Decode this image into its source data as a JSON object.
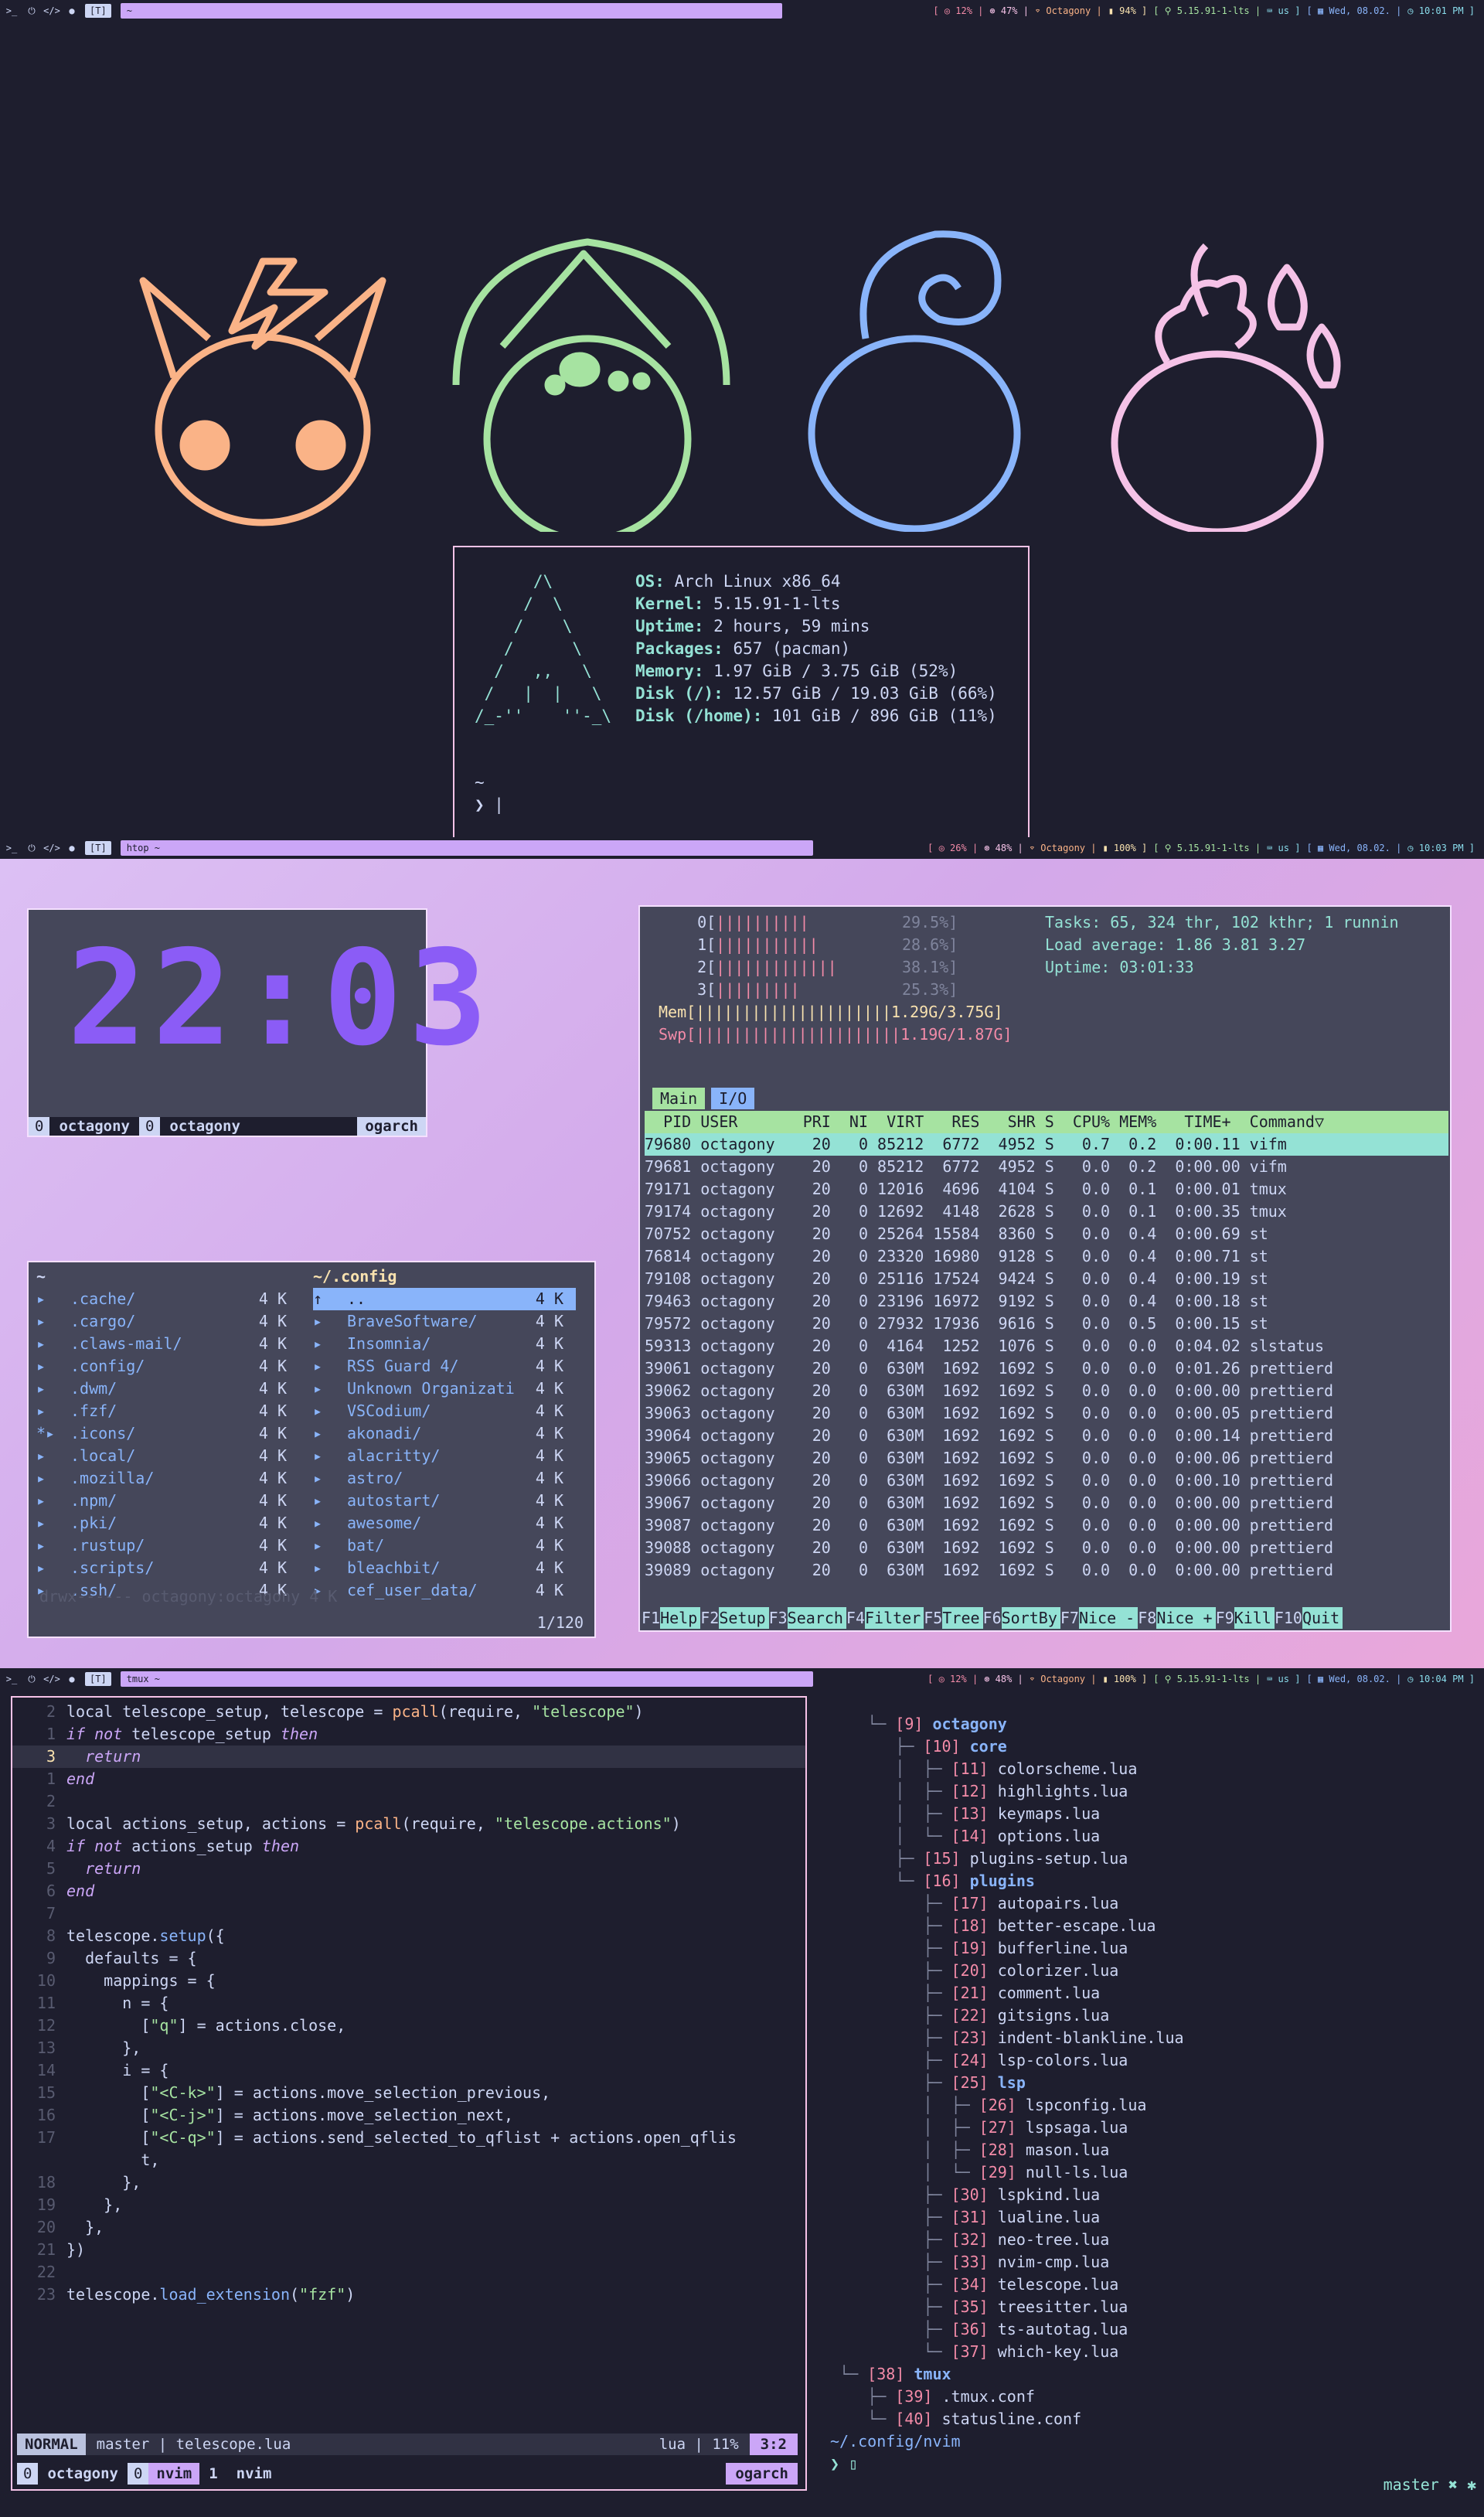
{
  "topbars": [
    {
      "tag": "[T]",
      "title": "~",
      "cpu": "12%",
      "mem": "47%",
      "wifi": "Octagony",
      "bat": "94%",
      "kernel": "5.15.91-1-lts",
      "kbd": "us",
      "date": "Wed, 08.02.",
      "time": "10:01 PM"
    },
    {
      "tag": "[T]",
      "title": "htop ~",
      "cpu": "26%",
      "mem": "48%",
      "wifi": "Octagony",
      "bat": "100%",
      "kernel": "5.15.91-1-lts",
      "kbd": "us",
      "date": "Wed, 08.02.",
      "time": "10:03 PM"
    },
    {
      "tag": "[T]",
      "title": "tmux ~",
      "cpu": "12%",
      "mem": "48%",
      "wifi": "Octagony",
      "bat": "100%",
      "kernel": "5.15.91-1-lts",
      "kbd": "us",
      "date": "Wed, 08.02.",
      "time": "10:04 PM"
    }
  ],
  "colors": {
    "peach": "#fab387",
    "green": "#a6e3a1",
    "blue": "#89b4fa",
    "pink": "#f5c2e7",
    "mauve": "#cba6f7",
    "teal": "#94e2d5"
  },
  "mascots": [
    "pikachu-icon",
    "bulbasaur-icon",
    "squirtle-icon",
    "charmander-icon"
  ],
  "fetch": {
    "logo": "      /\\\n     /  \\\n    /    \\\n   /      \\\n  /   ,,   \\\n /   |  |   \\\n/_-''    ''-_\\",
    "rows": [
      {
        "k": "OS:",
        "v": "Arch Linux x86_64"
      },
      {
        "k": "Kernel:",
        "v": "5.15.91-1-lts"
      },
      {
        "k": "Uptime:",
        "v": "2 hours, 59 mins"
      },
      {
        "k": "Packages:",
        "v": "657 (pacman)"
      },
      {
        "k": "Memory:",
        "v": "1.97 GiB / 3.75 GiB (52%)"
      },
      {
        "k": "Disk (/):",
        "v": "12.57 GiB / 19.03 GiB (66%)"
      },
      {
        "k": "Disk (/home):",
        "v": "101 GiB / 896 GiB (11%)"
      }
    ],
    "prompt1": "~",
    "prompt2": "❯ |"
  },
  "clock": {
    "time": "22:03",
    "s1": "0",
    "n1": "octagony",
    "s2": "0",
    "n2": "octagony",
    "host": "ogarch"
  },
  "vifm": {
    "left_title": "~",
    "right_title": "~/.config",
    "left": [
      {
        "n": ".cache/",
        "s": "4 K"
      },
      {
        "n": ".cargo/",
        "s": "4 K"
      },
      {
        "n": ".claws-mail/",
        "s": "4 K"
      },
      {
        "n": ".config/",
        "s": "4 K"
      },
      {
        "n": ".dwm/",
        "s": "4 K"
      },
      {
        "n": ".fzf/",
        "s": "4 K"
      },
      {
        "n": ".icons/",
        "s": "4 K"
      },
      {
        "n": ".local/",
        "s": "4 K"
      },
      {
        "n": ".mozilla/",
        "s": "4 K"
      },
      {
        "n": ".npm/",
        "s": "4 K"
      },
      {
        "n": ".pki/",
        "s": "4 K"
      },
      {
        "n": ".rustup/",
        "s": "4 K"
      },
      {
        "n": ".scripts/",
        "s": "4 K"
      },
      {
        "n": ".ssh/",
        "s": "4 K"
      }
    ],
    "right": [
      {
        "n": "..",
        "s": "4 K"
      },
      {
        "n": "BraveSoftware/",
        "s": "4 K"
      },
      {
        "n": "Insomnia/",
        "s": "4 K"
      },
      {
        "n": "RSS Guard 4/",
        "s": "4 K"
      },
      {
        "n": "Unknown Organizati",
        "s": "4 K"
      },
      {
        "n": "VSCodium/",
        "s": "4 K"
      },
      {
        "n": "akonadi/",
        "s": "4 K"
      },
      {
        "n": "alacritty/",
        "s": "4 K"
      },
      {
        "n": "astro/",
        "s": "4 K"
      },
      {
        "n": "autostart/",
        "s": "4 K"
      },
      {
        "n": "awesome/",
        "s": "4 K"
      },
      {
        "n": "bat/",
        "s": "4 K"
      },
      {
        "n": "bleachbit/",
        "s": "4 K"
      },
      {
        "n": "cef_user_data/",
        "s": "4 K"
      }
    ],
    "perm": "drwx------   octagony:octagony     4 K",
    "pos": "1/120"
  },
  "htop": {
    "cpus": [
      {
        "l": "0[",
        "b": "||||||||||",
        "p": "29.5%]"
      },
      {
        "l": "1[",
        "b": "|||||||||||",
        "p": "28.6%]"
      },
      {
        "l": "2[",
        "b": "|||||||||||||",
        "p": "38.1%]"
      },
      {
        "l": "3[",
        "b": "|||||||||",
        "p": "25.3%]"
      }
    ],
    "mem": "Mem[|||||||||||||||||||||1.29G/3.75G]",
    "swp": "Swp[||||||||||||||||||||||1.19G/1.87G]",
    "tasks": "Tasks: 65, 324 thr, 102 kthr; 1 runnin",
    "load": "Load average: 1.86 3.81 3.27",
    "uptime": "Uptime: 03:01:33",
    "tab_main": "Main",
    "tab_io": "I/O",
    "header": "  PID USER       PRI  NI  VIRT   RES   SHR S  CPU% MEM%   TIME+  Command▽",
    "rows": [
      "79680 octagony    20   0 85212  6772  4952 S   0.7  0.2  0:00.11 vifm",
      "79681 octagony    20   0 85212  6772  4952 S   0.0  0.2  0:00.00 vifm",
      "79171 octagony    20   0 12016  4696  4104 S   0.0  0.1  0:00.01 tmux",
      "79174 octagony    20   0 12692  4148  2628 S   0.0  0.1  0:00.35 tmux",
      "70752 octagony    20   0 25264 15584  8360 S   0.0  0.4  0:00.69 st",
      "76814 octagony    20   0 23320 16980  9128 S   0.0  0.4  0:00.71 st",
      "79108 octagony    20   0 25116 17524  9424 S   0.0  0.4  0:00.19 st",
      "79463 octagony    20   0 23196 16972  9192 S   0.0  0.4  0:00.18 st",
      "79572 octagony    20   0 27932 17936  9616 S   0.0  0.5  0:00.15 st",
      "59313 octagony    20   0  4164  1252  1076 S   0.0  0.0  0:04.02 slstatus",
      "39061 octagony    20   0  630M  1692  1692 S   0.0  0.0  0:01.26 prettierd",
      "39062 octagony    20   0  630M  1692  1692 S   0.0  0.0  0:00.00 prettierd",
      "39063 octagony    20   0  630M  1692  1692 S   0.0  0.0  0:00.05 prettierd",
      "39064 octagony    20   0  630M  1692  1692 S   0.0  0.0  0:00.14 prettierd",
      "39065 octagony    20   0  630M  1692  1692 S   0.0  0.0  0:00.06 prettierd",
      "39066 octagony    20   0  630M  1692  1692 S   0.0  0.0  0:00.10 prettierd",
      "39067 octagony    20   0  630M  1692  1692 S   0.0  0.0  0:00.00 prettierd",
      "39087 octagony    20   0  630M  1692  1692 S   0.0  0.0  0:00.00 prettierd",
      "39088 octagony    20   0  630M  1692  1692 S   0.0  0.0  0:00.00 prettierd",
      "39089 octagony    20   0  630M  1692  1692 S   0.0  0.0  0:00.00 prettierd"
    ],
    "fkeys": [
      {
        "k": "F1",
        "l": "Help"
      },
      {
        "k": "F2",
        "l": "Setup"
      },
      {
        "k": "F3",
        "l": "Search"
      },
      {
        "k": "F4",
        "l": "Filter"
      },
      {
        "k": "F5",
        "l": "Tree"
      },
      {
        "k": "F6",
        "l": "SortBy"
      },
      {
        "k": "F7",
        "l": "Nice -"
      },
      {
        "k": "F8",
        "l": "Nice +"
      },
      {
        "k": "F9",
        "l": "Kill"
      },
      {
        "k": "F10",
        "l": "Quit"
      }
    ]
  },
  "nvim": {
    "lines": [
      {
        "n": "2",
        "h": "<span class='kw2'>local</span> telescope_setup, telescope = <span class='pc'>pcall</span>(require, <span class='str'>\"telescope\"</span>)"
      },
      {
        "n": "1",
        "h": "<span class='kw'>if not</span> telescope_setup <span class='kw'>then</span>"
      },
      {
        "n": "3",
        "h": "  <span class='kw'>return</span>",
        "cur": true
      },
      {
        "n": "1",
        "h": "<span class='kw'>end</span>"
      },
      {
        "n": "2",
        "h": ""
      },
      {
        "n": "3",
        "h": "local actions_setup, actions = <span class='pc'>pcall</span>(require, <span class='str'>\"telescope.actions\"</span>)"
      },
      {
        "n": "4",
        "h": "<span class='kw'>if not</span> actions_setup <span class='kw'>then</span>"
      },
      {
        "n": "5",
        "h": "  <span class='kw'>return</span>"
      },
      {
        "n": "6",
        "h": "<span class='kw'>end</span>"
      },
      {
        "n": "7",
        "h": ""
      },
      {
        "n": "8",
        "h": "telescope.<span class='fn'>setup</span>({"
      },
      {
        "n": "9",
        "h": "  defaults = {"
      },
      {
        "n": "10",
        "h": "    mappings = {"
      },
      {
        "n": "11",
        "h": "      n = {"
      },
      {
        "n": "12",
        "h": "        [<span class='str'>\"q\"</span>] = actions.close,"
      },
      {
        "n": "13",
        "h": "      },"
      },
      {
        "n": "14",
        "h": "      i = {"
      },
      {
        "n": "15",
        "h": "        [<span class='str'>\"&lt;C-k&gt;\"</span>] = actions.move_selection_previous,"
      },
      {
        "n": "16",
        "h": "        [<span class='str'>\"&lt;C-j&gt;\"</span>] = actions.move_selection_next,"
      },
      {
        "n": "17",
        "h": "        [<span class='str'>\"&lt;C-q&gt;\"</span>] = actions.send_selected_to_qflist + actions.open_qflis"
      },
      {
        "n": "",
        "h": "        t,"
      },
      {
        "n": "18",
        "h": "      },"
      },
      {
        "n": "19",
        "h": "    },"
      },
      {
        "n": "20",
        "h": "  },"
      },
      {
        "n": "21",
        "h": "})"
      },
      {
        "n": "22",
        "h": ""
      },
      {
        "n": "23",
        "h": "telescope.<span class='fn'>load_extension</span>(<span class='str'>\"fzf\"</span>)"
      }
    ],
    "mode": "NORMAL",
    "branch": " master | telescope.lua",
    "ft": "lua | 11%",
    "pos": "3:2",
    "tmux": {
      "s0": "0",
      "n0": "octagony",
      "s1": "0",
      "w1": "nvim",
      "s2": "1",
      "w2": "nvim",
      "host": "ogarch"
    }
  },
  "tree": {
    "lines": [
      {
        "p": "    └─ ",
        "n": "[9]",
        "t": "octagony",
        "d": true
      },
      {
        "p": "       ├─ ",
        "n": "[10]",
        "t": "core",
        "d": true
      },
      {
        "p": "       │  ├─ ",
        "n": "[11]",
        "t": "colorscheme.lua"
      },
      {
        "p": "       │  ├─ ",
        "n": "[12]",
        "t": "highlights.lua"
      },
      {
        "p": "       │  ├─ ",
        "n": "[13]",
        "t": "keymaps.lua"
      },
      {
        "p": "       │  └─ ",
        "n": "[14]",
        "t": "options.lua"
      },
      {
        "p": "       ├─ ",
        "n": "[15]",
        "t": "plugins-setup.lua"
      },
      {
        "p": "       └─ ",
        "n": "[16]",
        "t": "plugins",
        "d": true
      },
      {
        "p": "          ├─ ",
        "n": "[17]",
        "t": "autopairs.lua"
      },
      {
        "p": "          ├─ ",
        "n": "[18]",
        "t": "better-escape.lua"
      },
      {
        "p": "          ├─ ",
        "n": "[19]",
        "t": "bufferline.lua"
      },
      {
        "p": "          ├─ ",
        "n": "[20]",
        "t": "colorizer.lua"
      },
      {
        "p": "          ├─ ",
        "n": "[21]",
        "t": "comment.lua"
      },
      {
        "p": "          ├─ ",
        "n": "[22]",
        "t": "gitsigns.lua"
      },
      {
        "p": "          ├─ ",
        "n": "[23]",
        "t": "indent-blankline.lua"
      },
      {
        "p": "          ├─ ",
        "n": "[24]",
        "t": "lsp-colors.lua"
      },
      {
        "p": "          ├─ ",
        "n": "[25]",
        "t": "lsp",
        "d": true
      },
      {
        "p": "          │  ├─ ",
        "n": "[26]",
        "t": "lspconfig.lua"
      },
      {
        "p": "          │  ├─ ",
        "n": "[27]",
        "t": "lspsaga.lua"
      },
      {
        "p": "          │  ├─ ",
        "n": "[28]",
        "t": "mason.lua"
      },
      {
        "p": "          │  └─ ",
        "n": "[29]",
        "t": "null-ls.lua"
      },
      {
        "p": "          ├─ ",
        "n": "[30]",
        "t": "lspkind.lua"
      },
      {
        "p": "          ├─ ",
        "n": "[31]",
        "t": "lualine.lua"
      },
      {
        "p": "          ├─ ",
        "n": "[32]",
        "t": "neo-tree.lua"
      },
      {
        "p": "          ├─ ",
        "n": "[33]",
        "t": "nvim-cmp.lua"
      },
      {
        "p": "          ├─ ",
        "n": "[34]",
        "t": "telescope.lua"
      },
      {
        "p": "          ├─ ",
        "n": "[35]",
        "t": "treesitter.lua"
      },
      {
        "p": "          ├─ ",
        "n": "[36]",
        "t": "ts-autotag.lua"
      },
      {
        "p": "          └─ ",
        "n": "[37]",
        "t": "which-key.lua"
      },
      {
        "p": " └─ ",
        "n": "[38]",
        "t": "tmux",
        "d": true
      },
      {
        "p": "    ├─ ",
        "n": "[39]",
        "t": ".tmux.conf"
      },
      {
        "p": "    └─ ",
        "n": "[40]",
        "t": "statusline.conf"
      }
    ],
    "cwd": "~/.config/nvim",
    "prompt": "❯ ▯",
    "git": "master ✖ ✱"
  }
}
